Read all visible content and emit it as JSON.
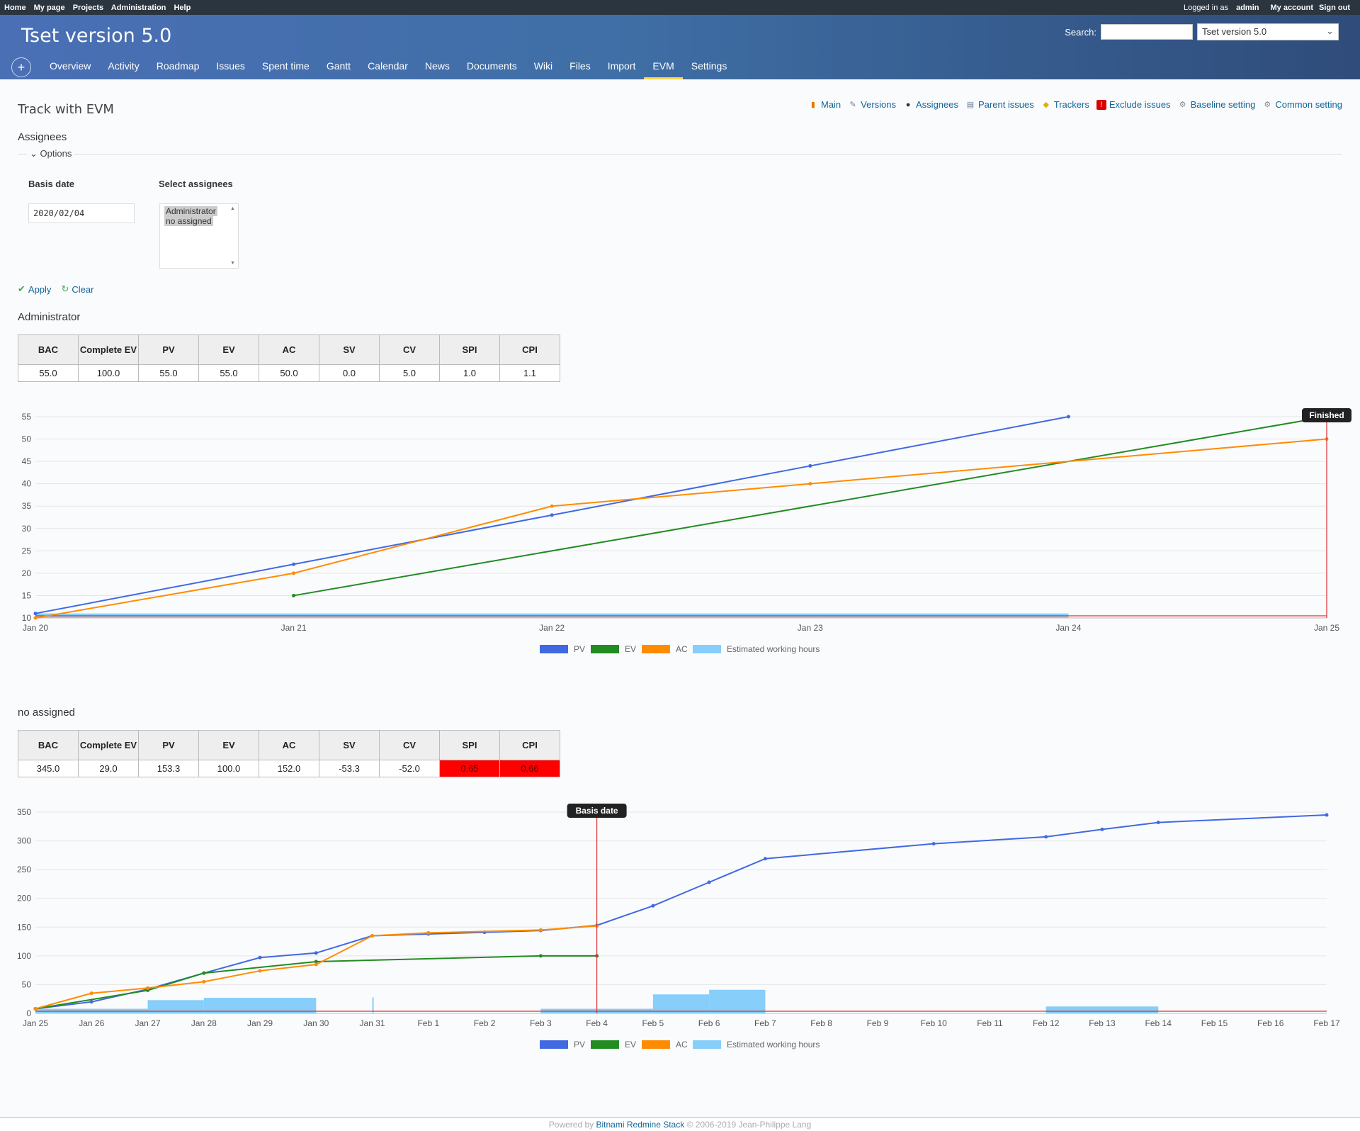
{
  "top_menu": {
    "left": [
      "Home",
      "My page",
      "Projects",
      "Administration",
      "Help"
    ],
    "logged_in_prefix": "Logged in as",
    "user": "admin",
    "my_account": "My account",
    "sign_out": "Sign out"
  },
  "header": {
    "title": "Tset version 5.0",
    "search_label": "Search:",
    "project_select": "Tset version 5.0"
  },
  "main_menu": [
    "Overview",
    "Activity",
    "Roadmap",
    "Issues",
    "Spent time",
    "Gantt",
    "Calendar",
    "News",
    "Documents",
    "Wiki",
    "Files",
    "Import",
    "EVM",
    "Settings"
  ],
  "main_menu_selected": "EVM",
  "page": {
    "title": "Track with EVM",
    "subtitle": "Assignees",
    "options_label": "Options",
    "basis_date_label": "Basis date",
    "basis_date_value": "2020/02/04",
    "select_assignees_label": "Select assignees",
    "assignee_options": [
      "Administrator",
      "no assigned"
    ],
    "apply": "Apply",
    "clear": "Clear"
  },
  "contextual": [
    "Main",
    "Versions",
    "Assignees",
    "Parent issues",
    "Trackers",
    "Exclude issues",
    "Baseline setting",
    "Common setting"
  ],
  "table_headers": [
    "BAC",
    "Complete EV",
    "PV",
    "EV",
    "AC",
    "SV",
    "CV",
    "SPI",
    "CPI"
  ],
  "sections": [
    {
      "name": "Administrator",
      "values": [
        "55.0",
        "100.0",
        "55.0",
        "55.0",
        "50.0",
        "0.0",
        "5.0",
        "1.0",
        "1.1"
      ],
      "bad_cells": []
    },
    {
      "name": "no assigned",
      "values": [
        "345.0",
        "29.0",
        "153.3",
        "100.0",
        "152.0",
        "-53.3",
        "-52.0",
        "0.65",
        "0.66"
      ],
      "bad_cells": [
        7,
        8
      ]
    }
  ],
  "legend_labels": [
    "PV",
    "EV",
    "AC",
    "Estimated working hours"
  ],
  "colors": {
    "pv": "#4169e1",
    "ev": "#228b22",
    "ac": "#ff8c00",
    "est": "#87cefa",
    "marker": "#e03030"
  },
  "chart_data": [
    {
      "type": "line",
      "categories": [
        "Jan 20",
        "Jan 21",
        "Jan 22",
        "Jan 23",
        "Jan 24",
        "Jan 25"
      ],
      "ylim": [
        10,
        55
      ],
      "yticks": [
        10,
        15,
        20,
        25,
        30,
        35,
        40,
        45,
        50,
        55
      ],
      "series": [
        {
          "name": "PV",
          "x": [
            0,
            1,
            2,
            3,
            4
          ],
          "values": [
            11,
            22,
            33,
            44,
            55
          ]
        },
        {
          "name": "EV",
          "x": [
            1,
            5
          ],
          "values": [
            15,
            55
          ]
        },
        {
          "name": "AC",
          "x": [
            0,
            1,
            2,
            3,
            5
          ],
          "values": [
            10,
            20,
            35,
            40,
            50
          ]
        },
        {
          "name": "Estimated working hours",
          "x_start": [
            0
          ],
          "x_end": [
            4
          ],
          "values": [
            11
          ]
        }
      ],
      "marker": {
        "label": "Finished",
        "x": 5
      },
      "legend": "bottom"
    },
    {
      "type": "line",
      "categories": [
        "Jan 25",
        "Jan 26",
        "Jan 27",
        "Jan 28",
        "Jan 29",
        "Jan 30",
        "Jan 31",
        "Feb 1",
        "Feb 2",
        "Feb 3",
        "Feb 4",
        "Feb 5",
        "Feb 6",
        "Feb 7",
        "Feb 8",
        "Feb 9",
        "Feb 10",
        "Feb 11",
        "Feb 12",
        "Feb 13",
        "Feb 14",
        "Feb 15",
        "Feb 16",
        "Feb 17"
      ],
      "ylim": [
        0,
        350
      ],
      "yticks": [
        0,
        50,
        100,
        150,
        200,
        250,
        300,
        350
      ],
      "series": [
        {
          "name": "PV",
          "x": [
            0,
            1,
            2,
            3,
            4,
            5,
            6,
            7,
            8,
            9,
            10,
            11,
            12,
            13,
            16,
            18,
            19,
            20,
            23
          ],
          "values": [
            8,
            20,
            42,
            70,
            97,
            105,
            135,
            138,
            141,
            144,
            153,
            187,
            228,
            269,
            295,
            307,
            320,
            332,
            345
          ]
        },
        {
          "name": "EV",
          "x": [
            0,
            2,
            3,
            5,
            9,
            10
          ],
          "values": [
            8,
            40,
            70,
            90,
            100,
            100
          ]
        },
        {
          "name": "AC",
          "x": [
            0,
            1,
            2,
            3,
            4,
            5,
            6,
            7,
            9,
            10
          ],
          "values": [
            8,
            35,
            44,
            55,
            74,
            85,
            135,
            140,
            145,
            152
          ]
        },
        {
          "name": "Estimated working hours",
          "x_start": [
            0,
            2,
            3,
            6,
            9,
            11,
            12,
            18
          ],
          "x_end": [
            2,
            3,
            5,
            6,
            11,
            12,
            13,
            20
          ],
          "values": [
            8,
            23,
            27,
            28,
            8,
            33,
            41,
            12
          ]
        }
      ],
      "marker": {
        "label": "Basis date",
        "x": 10
      },
      "legend": "bottom"
    }
  ],
  "footer": {
    "prefix": "Powered by",
    "link": "Bitnami Redmine Stack",
    "suffix": "© 2006-2019 Jean-Philippe Lang"
  }
}
